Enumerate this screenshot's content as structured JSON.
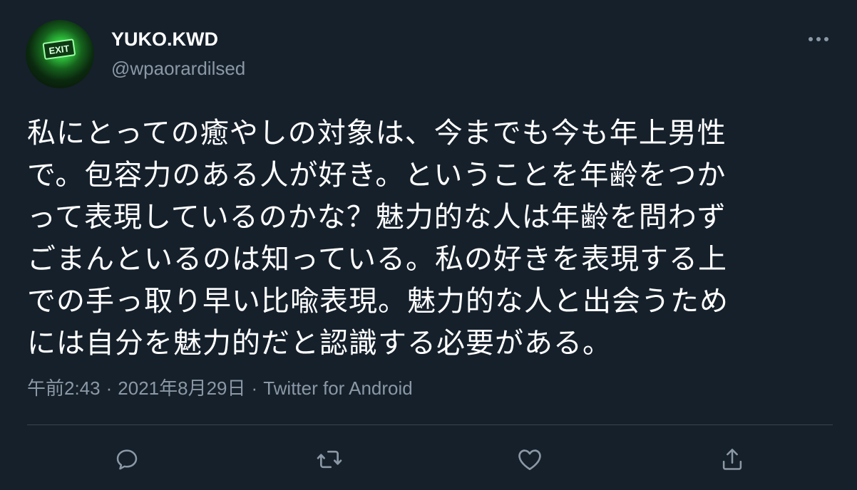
{
  "tweet": {
    "display_name": "YUKO.KWD",
    "handle": "@wpaorardilsed",
    "avatar_sign_text": "EXIT",
    "text_lines": [
      "私にとっての癒やしの対象は、今までも今も年上男性",
      "で。包容力のある人が好き。ということを年齢をつか",
      "って表現しているのかな？魅力的な人は年齢を問わず",
      "ごまんといるのは知っている。私の好きを表現する上",
      "での手っ取り早い比喩表現。魅力的な人と出会うため",
      "には自分を魅力的だと認識する必要がある。"
    ],
    "time": "午前2:43",
    "date": "2021年8月29日",
    "separator": "·",
    "source": "Twitter for Android"
  },
  "icons": {
    "more": "more-dots-icon",
    "reply": "reply-icon",
    "retweet": "retweet-icon",
    "like": "heart-icon",
    "share": "share-icon"
  },
  "colors": {
    "background": "#15202b",
    "text": "#ffffff",
    "secondary_text": "#8b98a5",
    "divider": "#38444d",
    "avatar_glow": "#2fbf3c"
  }
}
